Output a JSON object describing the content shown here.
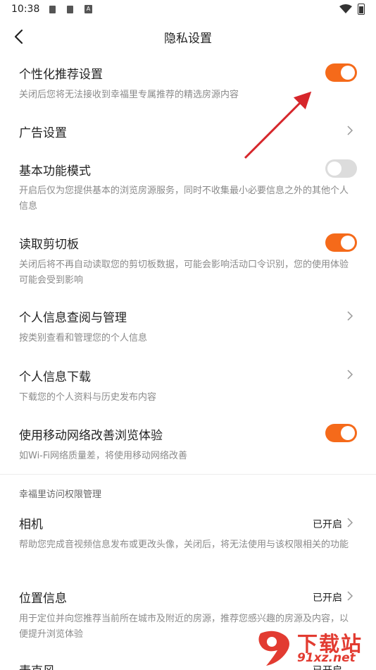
{
  "status_bar": {
    "time": "10:38",
    "a_icon": "A"
  },
  "header": {
    "title": "隐私设置"
  },
  "settings": [
    {
      "title": "个性化推荐设置",
      "desc": "关闭后您将无法接收到幸福里专属推荐的精选房源内容",
      "control": "toggle",
      "on": true
    },
    {
      "title": "广告设置",
      "control": "chevron"
    },
    {
      "title": "基本功能模式",
      "desc": "开启后仅为您提供基本的浏览房源服务，同时不收集最小必要信息之外的其他个人信息",
      "control": "toggle",
      "on": false
    },
    {
      "title": "读取剪切板",
      "desc": "关闭后将不再自动读取您的剪切板数据，可能会影响活动口令识别，您的使用体验可能会受到影响",
      "control": "toggle",
      "on": true
    },
    {
      "title": "个人信息查阅与管理",
      "desc": "按类别查看和管理您的个人信息",
      "control": "chevron"
    },
    {
      "title": "个人信息下载",
      "desc": "下载您的个人资料与历史发布内容",
      "control": "chevron"
    },
    {
      "title": "使用移动网络改善浏览体验",
      "desc": "如Wi-Fi网络质量差，将使用移动网络改善",
      "control": "toggle",
      "on": true
    }
  ],
  "permissions": {
    "section_label": "幸福里访问权限管理",
    "items": [
      {
        "title": "相机",
        "status": "已开启",
        "desc": "帮助您完成音视频信息发布或更改头像，关闭后，将无法使用与该权限相关的功能"
      },
      {
        "title": "位置信息",
        "status": "已开启",
        "desc": "用于定位并向您推荐当前所在城市及附近的房源，推荐您感兴趣的房源及内容，以便提升浏览体验"
      },
      {
        "title": "麦克风",
        "status": "已开启"
      }
    ]
  },
  "watermark": {
    "text": "下载站",
    "url": "91xz.net"
  },
  "colors": {
    "accent": "#f56a1a",
    "annotation_arrow": "#d6262b",
    "watermark": "#e23b31"
  }
}
